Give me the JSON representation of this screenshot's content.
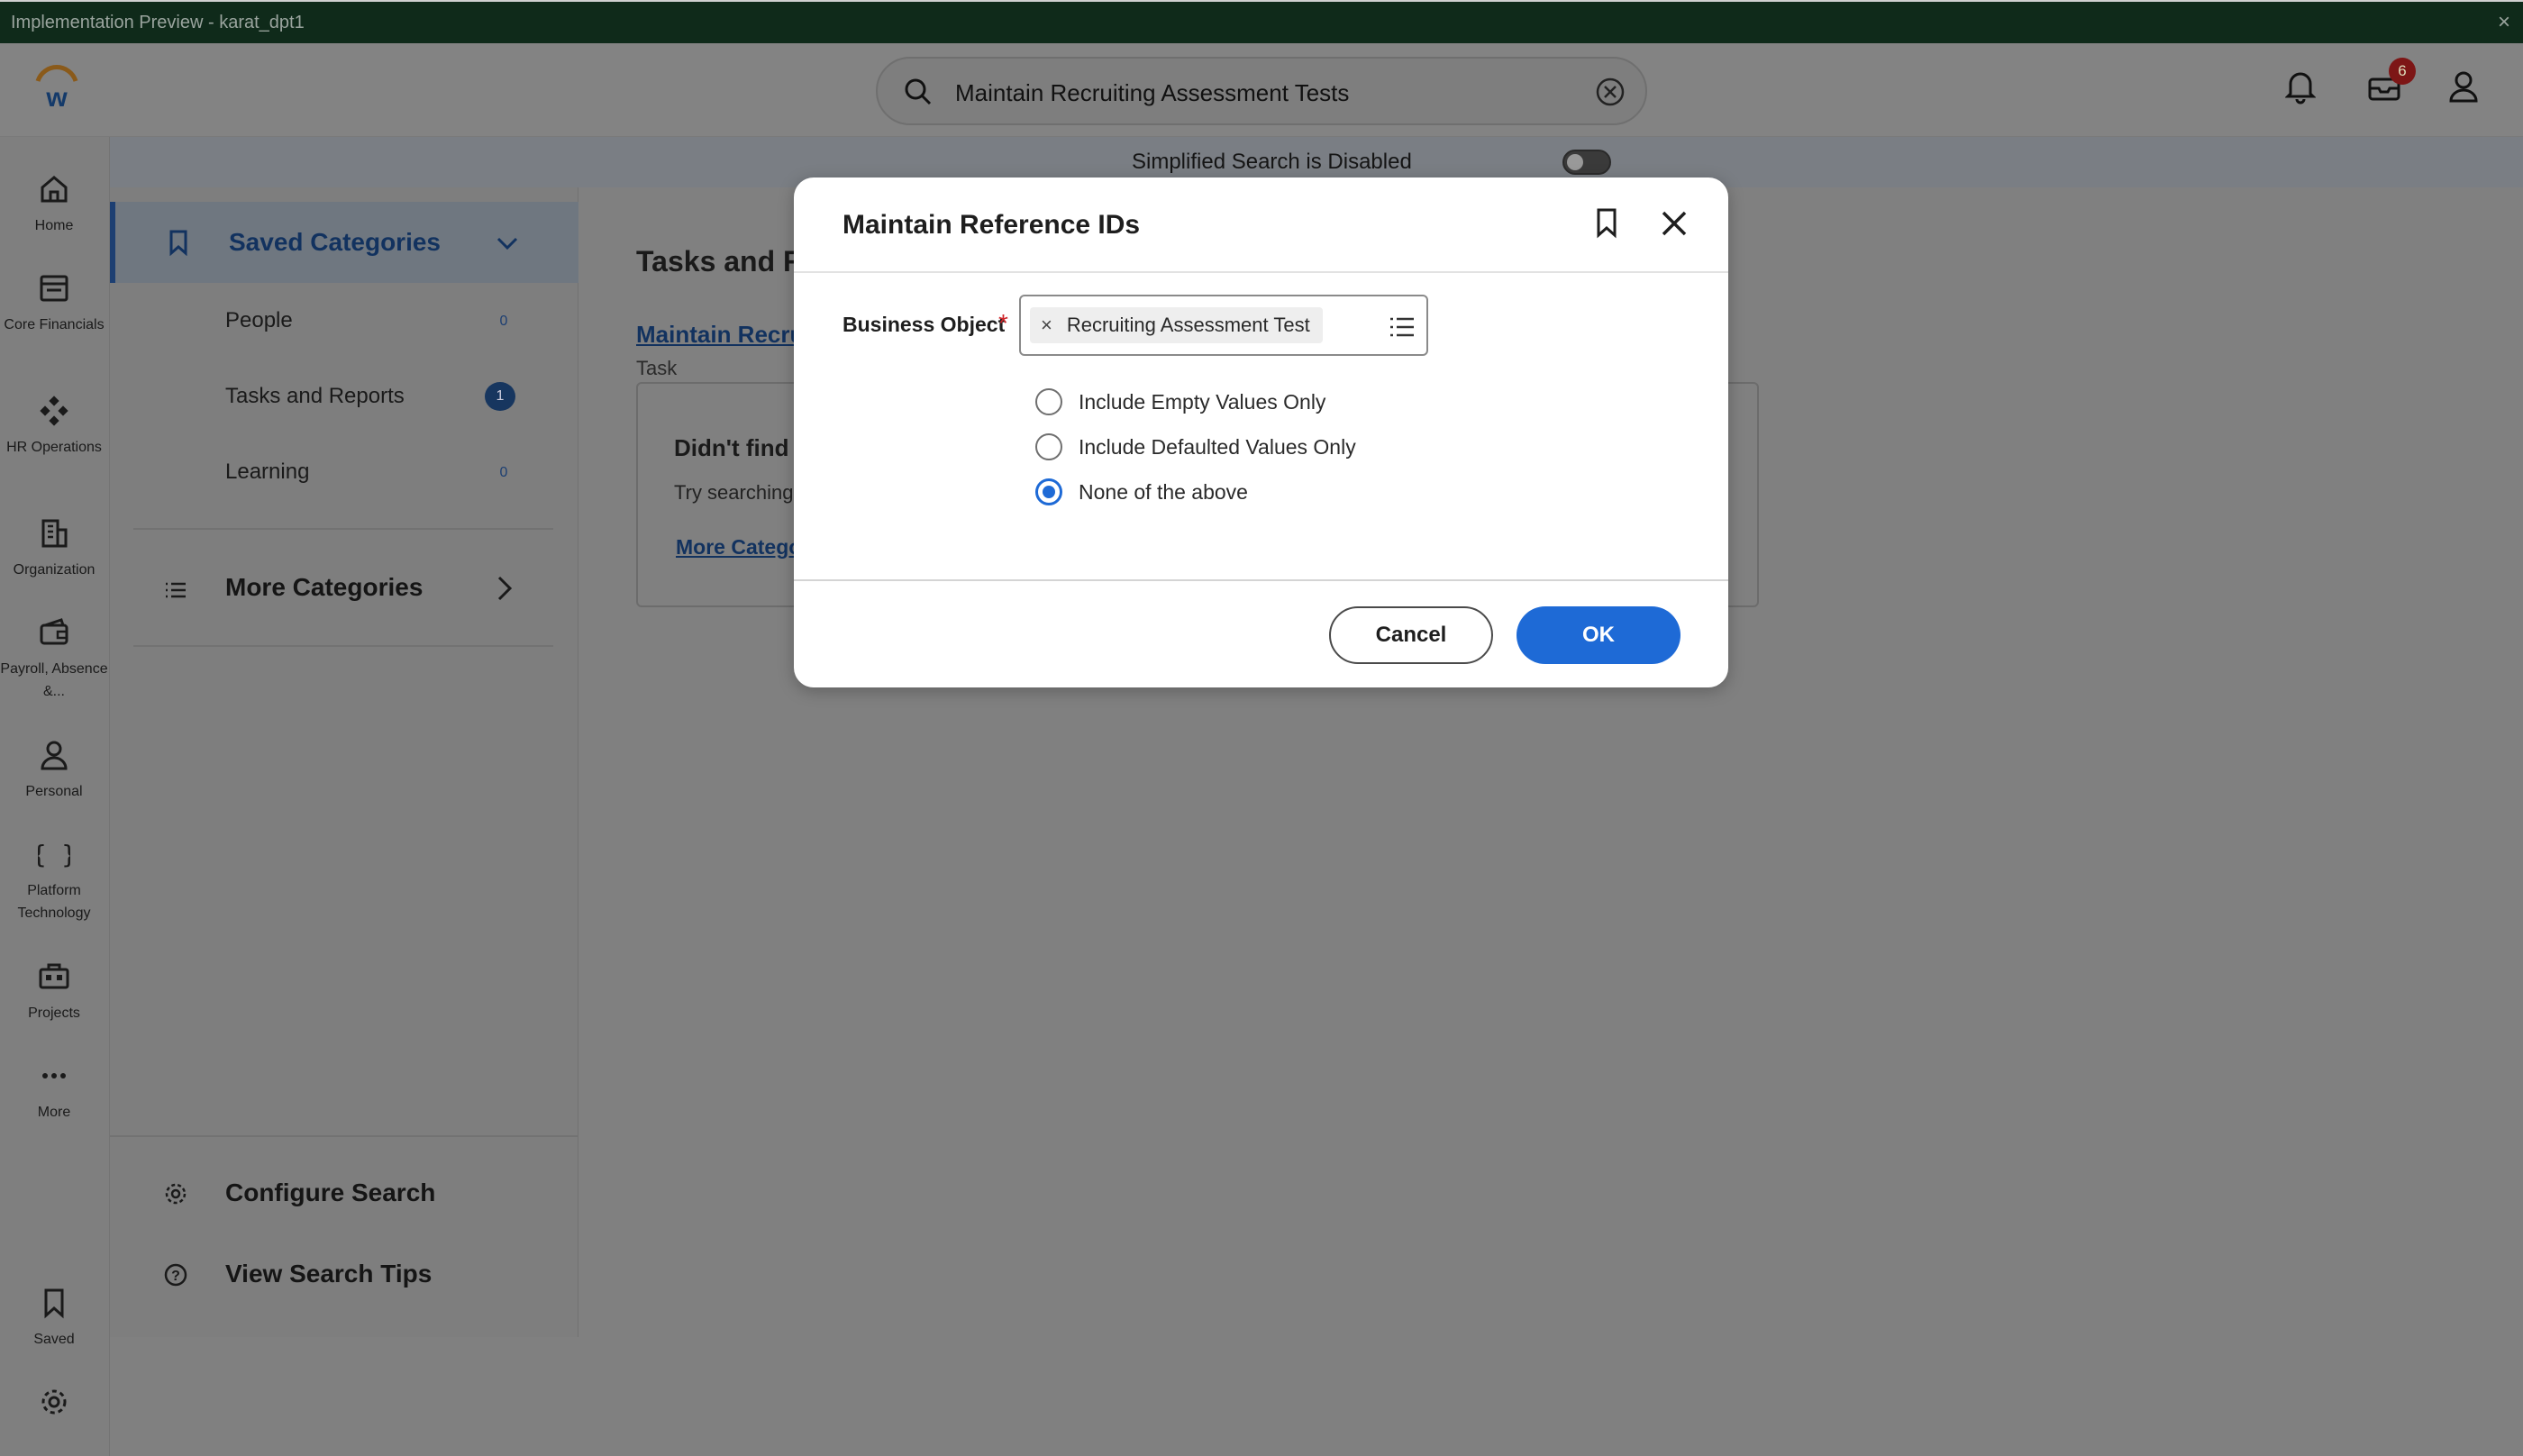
{
  "window": {
    "title": "Implementation Preview - karat_dpt1",
    "close": "×"
  },
  "header": {
    "search_query": "Maintain Recruiting Assessment Tests",
    "inbox_badge": "6"
  },
  "leftnav": {
    "items": [
      {
        "label": "Home",
        "icon": "home-icon"
      },
      {
        "label": "Core Financials",
        "icon": "core-financials-icon"
      },
      {
        "label": "HR Operations",
        "icon": "hr-operations-icon"
      },
      {
        "label": "Organization",
        "icon": "organization-icon"
      },
      {
        "label": "Payroll, Absence &...",
        "icon": "payroll-icon"
      },
      {
        "label": "Personal",
        "icon": "personal-icon"
      },
      {
        "label": "Platform Technology",
        "icon": "platform-icon"
      },
      {
        "label": "Projects",
        "icon": "projects-icon"
      },
      {
        "label": "More",
        "icon": "more-icon"
      },
      {
        "label": "Saved",
        "icon": "saved-icon"
      }
    ]
  },
  "banner": {
    "text": "Simplified Search is Disabled",
    "toggle_on": false
  },
  "categories": {
    "saved_label": "Saved Categories",
    "items": [
      {
        "label": "People",
        "count": "0"
      },
      {
        "label": "Tasks and Reports",
        "count": "1"
      },
      {
        "label": "Learning",
        "count": "0"
      }
    ],
    "more_label": "More Categories",
    "configure_label": "Configure Search",
    "tips_label": "View Search Tips"
  },
  "main": {
    "heading": "Tasks and R",
    "result_link": "Maintain Recru",
    "result_type": "Task",
    "card_heading": "Didn't find v",
    "card_text": "Try searching",
    "card_link": "More Catego"
  },
  "modal": {
    "title": "Maintain Reference IDs",
    "field_label": "Business Object",
    "required_mark": "*",
    "chip_value": "Recruiting Assessment Test",
    "options": [
      {
        "label": "Include Empty Values Only",
        "selected": false
      },
      {
        "label": "Include Defaulted Values Only",
        "selected": false
      },
      {
        "label": "None of the above",
        "selected": true
      }
    ],
    "cancel_label": "Cancel",
    "ok_label": "OK"
  },
  "colors": {
    "accent": "#1e6ad6",
    "required": "#d0272c",
    "badge": "#7d1616"
  }
}
